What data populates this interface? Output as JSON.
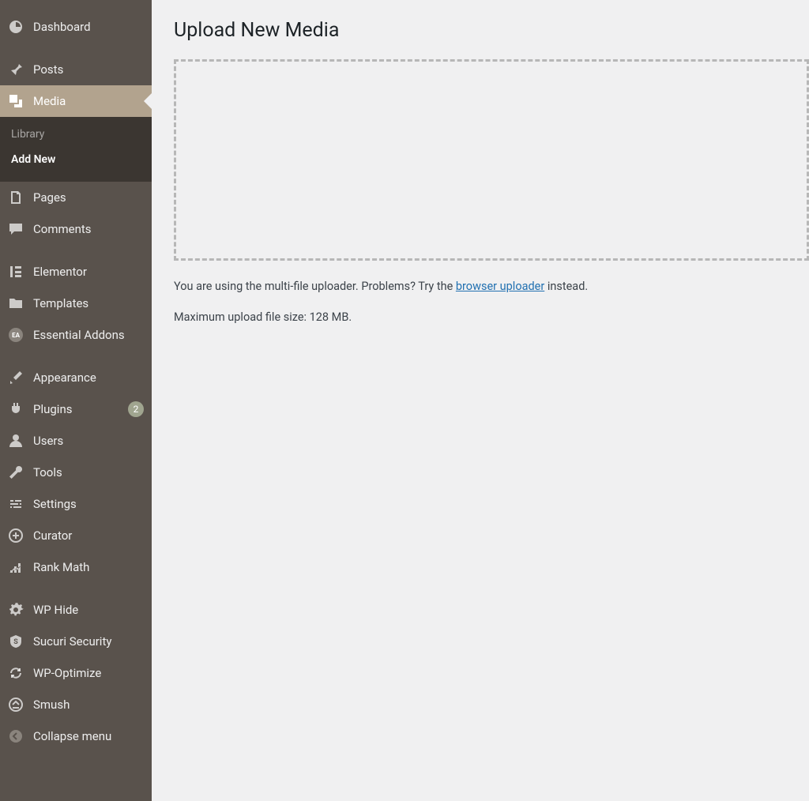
{
  "sidebar": {
    "items": [
      {
        "label": "Dashboard"
      },
      {
        "label": "Posts"
      },
      {
        "label": "Media"
      },
      {
        "label": "Pages"
      },
      {
        "label": "Comments"
      },
      {
        "label": "Elementor"
      },
      {
        "label": "Templates"
      },
      {
        "label": "Essential Addons"
      },
      {
        "label": "Appearance"
      },
      {
        "label": "Plugins",
        "badge": "2"
      },
      {
        "label": "Users"
      },
      {
        "label": "Tools"
      },
      {
        "label": "Settings"
      },
      {
        "label": "Curator"
      },
      {
        "label": "Rank Math"
      },
      {
        "label": "WP Hide"
      },
      {
        "label": "Sucuri Security"
      },
      {
        "label": "WP-Optimize"
      },
      {
        "label": "Smush"
      },
      {
        "label": "Collapse menu"
      }
    ],
    "submenu": {
      "library": "Library",
      "add_new": "Add New"
    }
  },
  "main": {
    "title": "Upload New Media",
    "hint_prefix": "You are using the multi-file uploader. Problems? Try the ",
    "hint_link": "browser uploader",
    "hint_suffix": " instead.",
    "max_size": "Maximum upload file size: 128 MB."
  }
}
